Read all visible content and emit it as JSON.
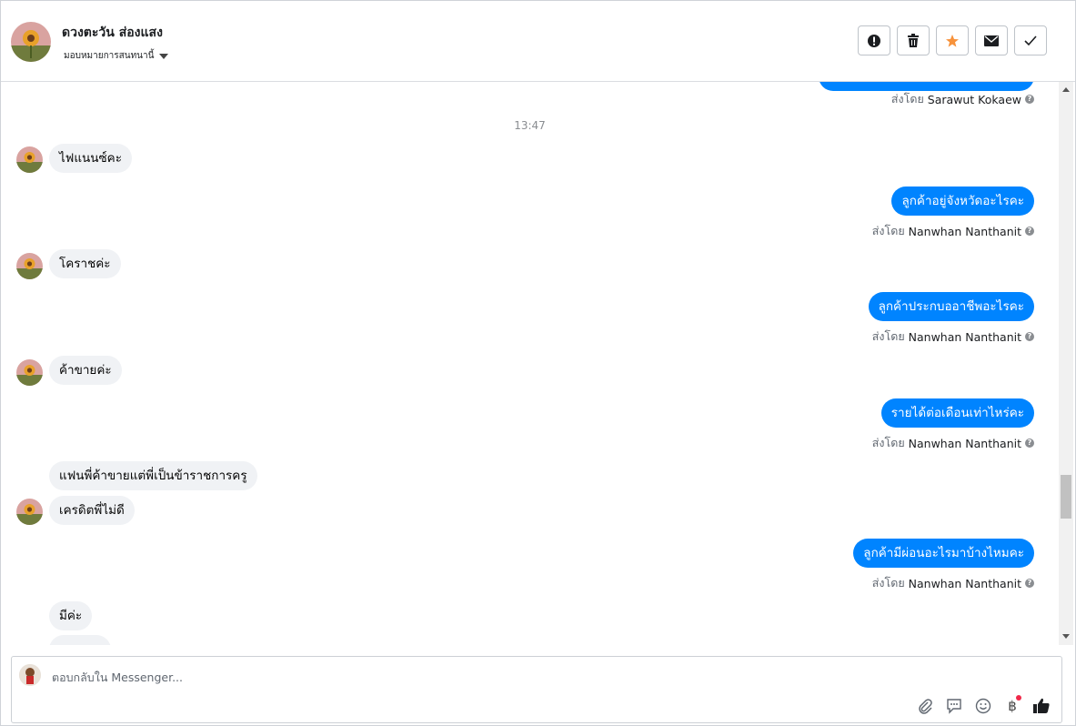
{
  "header": {
    "contact_name": "ดวงตะวัน ส่องแสง",
    "assign_label": "มอบหมายการสนทนานี้",
    "actions": [
      {
        "name": "spam-button",
        "icon": "alert-icon"
      },
      {
        "name": "delete-button",
        "icon": "trash-icon"
      },
      {
        "name": "star-button",
        "icon": "star-icon"
      },
      {
        "name": "mark-unread-button",
        "icon": "envelope-icon"
      },
      {
        "name": "done-button",
        "icon": "check-icon"
      }
    ]
  },
  "conversation": {
    "sent_prefix": "ส่งโดย",
    "top_sender": "Sarawut Kokaew",
    "timestamp": "13:47",
    "messages": [
      {
        "dir": "in",
        "text": "ไฟแนนซ์คะ"
      },
      {
        "dir": "out",
        "text": "ลูกค้าอยู่จังหวัดอะไรคะ",
        "sender": "Nanwhan Nanthanit"
      },
      {
        "dir": "in",
        "text": "โคราชค่ะ"
      },
      {
        "dir": "out",
        "text": "ลูกค้าประกบออาชีพอะไรคะ",
        "sender": "Nanwhan Nanthanit"
      },
      {
        "dir": "in",
        "text": "ค้าขายค่ะ"
      },
      {
        "dir": "out",
        "text": "รายได้ต่อเดือนเท่าไหร่คะ",
        "sender": "Nanwhan Nanthanit"
      },
      {
        "dir": "in",
        "text": "แฟนพี่ค้าขายแต่พี่เป็นข้าราชการครู"
      },
      {
        "dir": "in",
        "text": "เครดิตพี่ไม่ดี"
      },
      {
        "dir": "out",
        "text": "ลูกค้ามีผ่อนอะไรมาบ้างไหมคะ",
        "sender": "Nanwhan Nanthanit"
      },
      {
        "dir": "in",
        "text": "มีค่ะ"
      }
    ]
  },
  "composer": {
    "placeholder": "ตอบกลับใน Messenger...",
    "tools": [
      "paperclip-icon",
      "saved-reply-icon",
      "emoji-icon",
      "baht-payment-icon",
      "like-icon"
    ],
    "baht_symbol": "฿"
  },
  "colors": {
    "outgoing_bubble": "#0084ff",
    "incoming_bubble": "#f0f2f5",
    "star_orange": "#f7923b"
  }
}
